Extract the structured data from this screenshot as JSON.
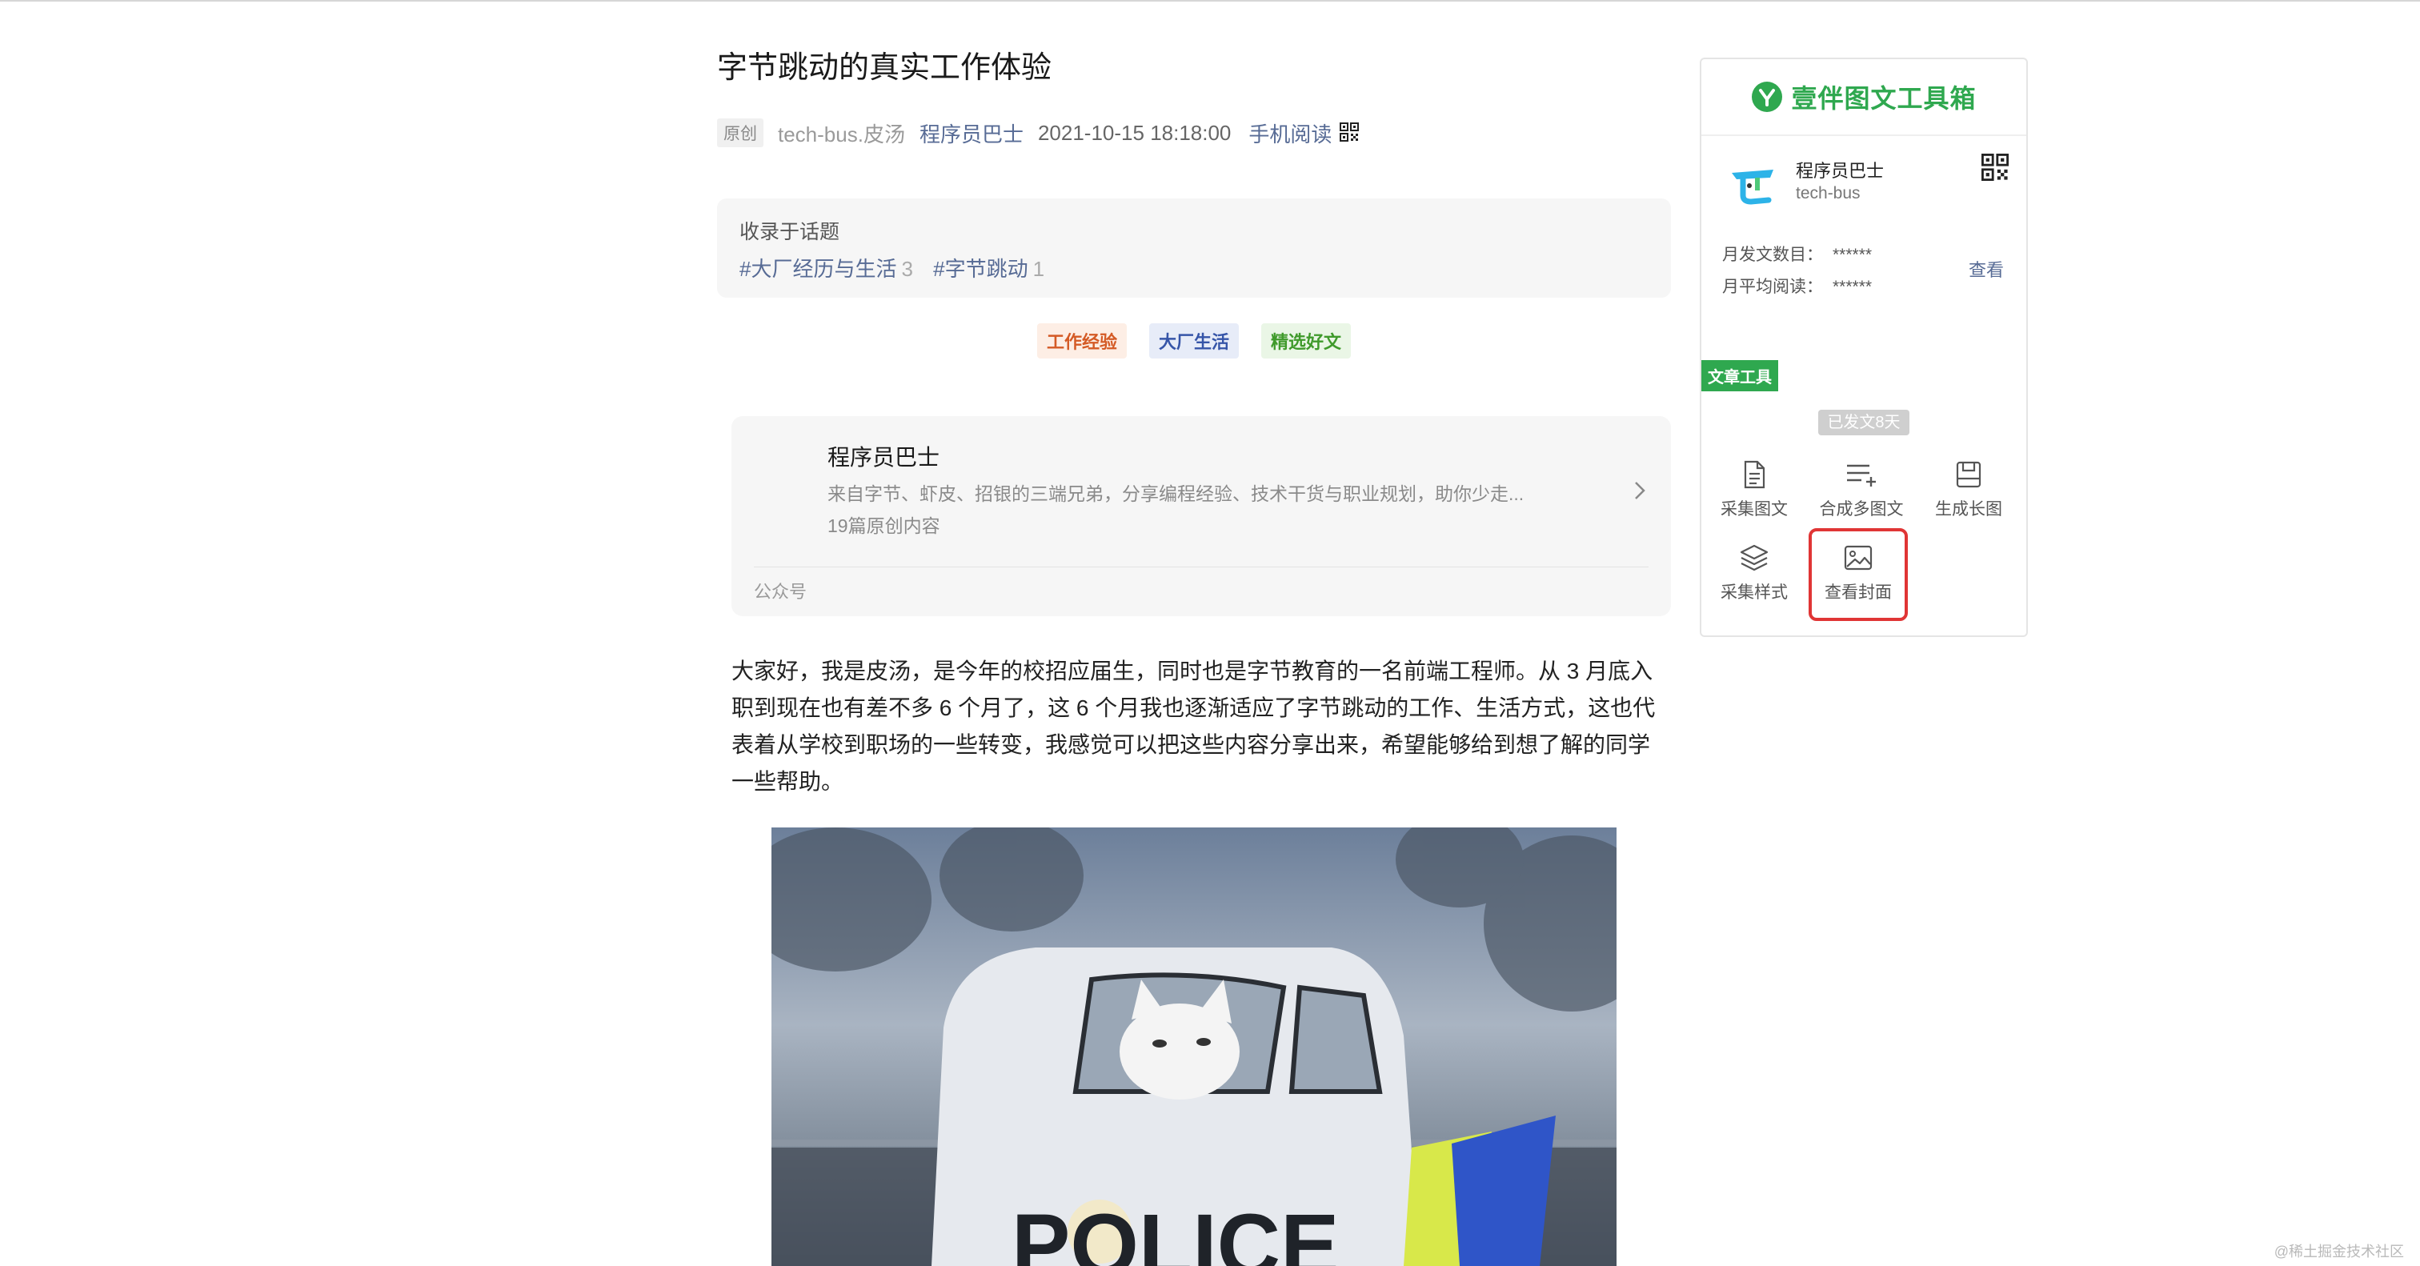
{
  "article": {
    "title": "字节跳动的真实工作体验",
    "original_badge": "原创",
    "author": "tech-bus.皮汤",
    "account_link": "程序员巴士",
    "date": "2021-10-15 18:18:00",
    "mobile_read": "手机阅读",
    "topics": {
      "heading": "收录于话题",
      "items": [
        {
          "label": "#大厂经历与生活",
          "count": "3"
        },
        {
          "label": "#字节跳动",
          "count": "1"
        }
      ]
    },
    "tags": [
      "工作经验",
      "大厂生活",
      "精选好文"
    ],
    "account_card": {
      "name": "程序员巴士",
      "description": "来自字节、虾皮、招银的三端兄弟，分享编程经验、技术干货与职业规划，助你少走...",
      "count": "19篇原创内容",
      "type": "公众号"
    },
    "body": "大家好，我是皮汤，是今年的校招应届生，同时也是字节教育的一名前端工程师。从 3 月底入职到现在也有差不多 6 个月了，这 6 个月我也逐渐适应了字节跳动的工作、生活方式，这也代表着从学校到职场的一些转变，我感觉可以把这些内容分享出来，希望能够给到想了解的同学一些帮助。",
    "photo_text": "POLICE"
  },
  "panel": {
    "title": "壹伴图文工具箱",
    "account_name": "程序员巴士",
    "account_id": "tech-bus",
    "monthly_posts_label": "月发文数目：",
    "monthly_posts_value": "******",
    "monthly_reads_label": "月平均阅读：",
    "monthly_reads_value": "******",
    "view_label": "查看",
    "tools_label": "文章工具",
    "published_badge": "已发文8天",
    "tools": [
      "采集图文",
      "合成多图文",
      "生成长图",
      "采集样式",
      "查看封面"
    ]
  },
  "watermark": "@稀土掘金技术社区",
  "colors": {
    "accent_green": "#2fa84f",
    "link_blue": "#576b95",
    "highlight_red": "#e03535"
  }
}
